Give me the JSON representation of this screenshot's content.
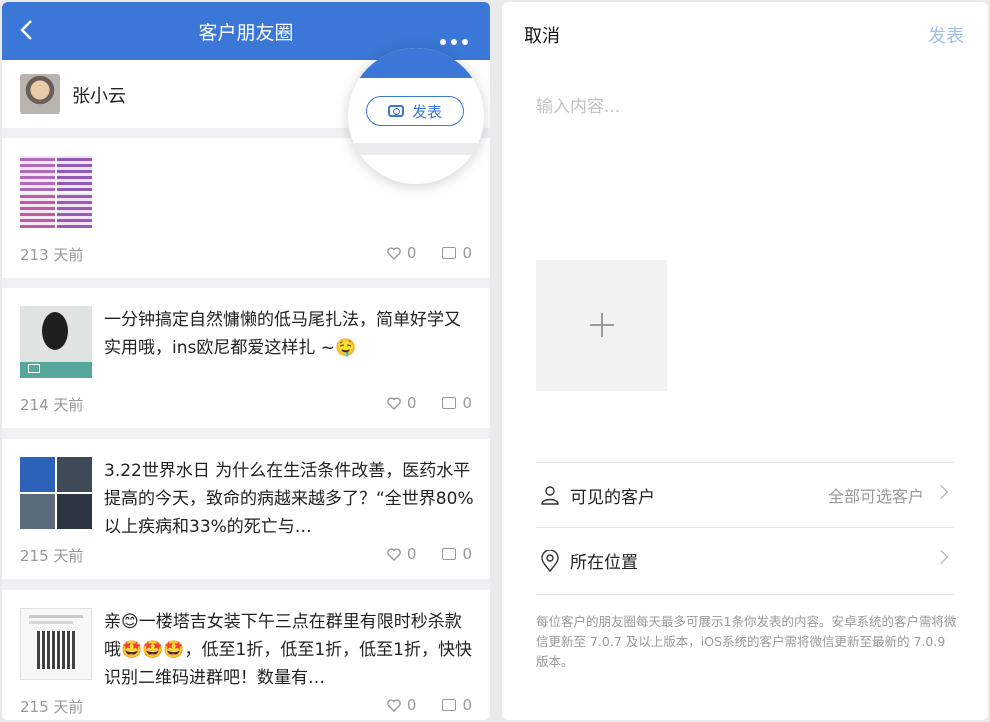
{
  "left": {
    "header": {
      "title": "客户朋友圈",
      "back_icon": "chevron-left-icon",
      "more_icon": "more-dots-icon",
      "bg": "#3a77d6"
    },
    "profile": {
      "name": "张小云"
    },
    "post_button": {
      "label": "发表",
      "icon": "camera-icon"
    },
    "posts": [
      {
        "text": "",
        "time": "213 天前",
        "likes": "0",
        "comments": "0"
      },
      {
        "text": "一分钟搞定自然慵懒的低马尾扎法，简单好学又实用哦，ins欧尼都爱这样扎 ~🤤",
        "time": "214 天前",
        "likes": "0",
        "comments": "0"
      },
      {
        "text": "3.22世界水日 为什么在生活条件改善，医药水平提高的今天，致命的病越来越多了？“全世界80%以上疾病和33%的死亡与…",
        "time": "215 天前",
        "likes": "0",
        "comments": "0"
      },
      {
        "text": "亲😊一楼塔吉女装下午三点在群里有限时秒杀款哦🤩🤩🤩，低至1折，低至1折，低至1折，快快识别二维码进群吧！数量有…",
        "time": "215 天前",
        "likes": "0",
        "comments": "0"
      }
    ]
  },
  "right": {
    "cancel_label": "取消",
    "publish_label": "发表",
    "input_placeholder": "输入内容...",
    "add_icon": "plus-icon",
    "visible_row": {
      "label": "可见的客户",
      "value": "全部可选客户",
      "icon": "person-icon"
    },
    "location_row": {
      "label": "所在位置",
      "icon": "location-pin-icon"
    },
    "note": "每位客户的朋友圈每天最多可展示1条你发表的内容。安卓系统的客户需将微信更新至 7.0.7 及以上版本，iOS系统的客户需将微信更新至最新的 7.0.9 版本。",
    "accent": "#9cc0ec"
  }
}
